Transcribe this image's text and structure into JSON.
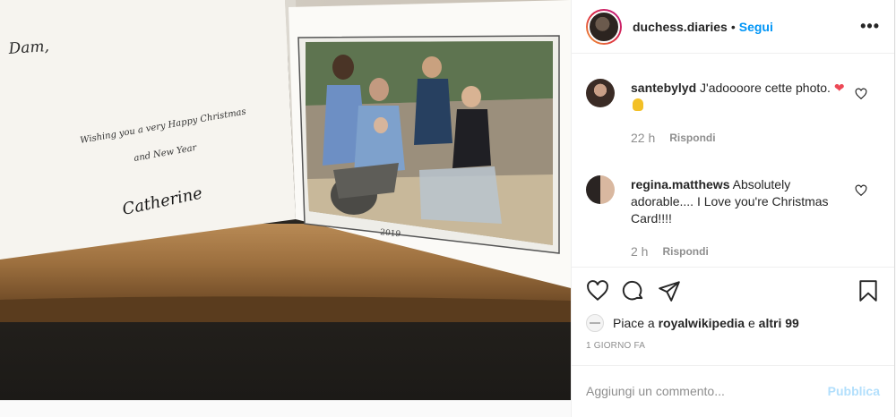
{
  "post": {
    "username": "duchess.diaries",
    "separator": "•",
    "follow_label": "Segui",
    "more_label": "•••"
  },
  "photo": {
    "card_left_text_1": "Dam,",
    "card_left_text_2": "Wishing you a very Happy Christmas",
    "card_left_text_3": "and New Year",
    "card_signature": "Catherine",
    "card_year": "2019"
  },
  "comments": [
    {
      "username": "santebylyd",
      "text": "J'adoooore cette photo.",
      "time": "22 h",
      "reply_label": "Rispondi"
    },
    {
      "username": "regina.matthews",
      "text": "Absolutely adorable.... I Love you're Christmas Card!!!!",
      "time": "2 h",
      "reply_label": "Rispondi"
    }
  ],
  "likes": {
    "prefix": "Piace a",
    "user": "royalwikipedia",
    "middle": "e",
    "others": "altri 99"
  },
  "time_ago": "1 GIORNO FA",
  "add_comment": {
    "placeholder": "Aggiungi un commento...",
    "publish_label": "Pubblica"
  },
  "colors": {
    "accent": "#0095f6",
    "publish_disabled": "#b2dffc",
    "heart": "#ed4956"
  },
  "icons": [
    "more-icon",
    "heart-icon",
    "comment-icon",
    "share-icon",
    "bookmark-icon"
  ]
}
